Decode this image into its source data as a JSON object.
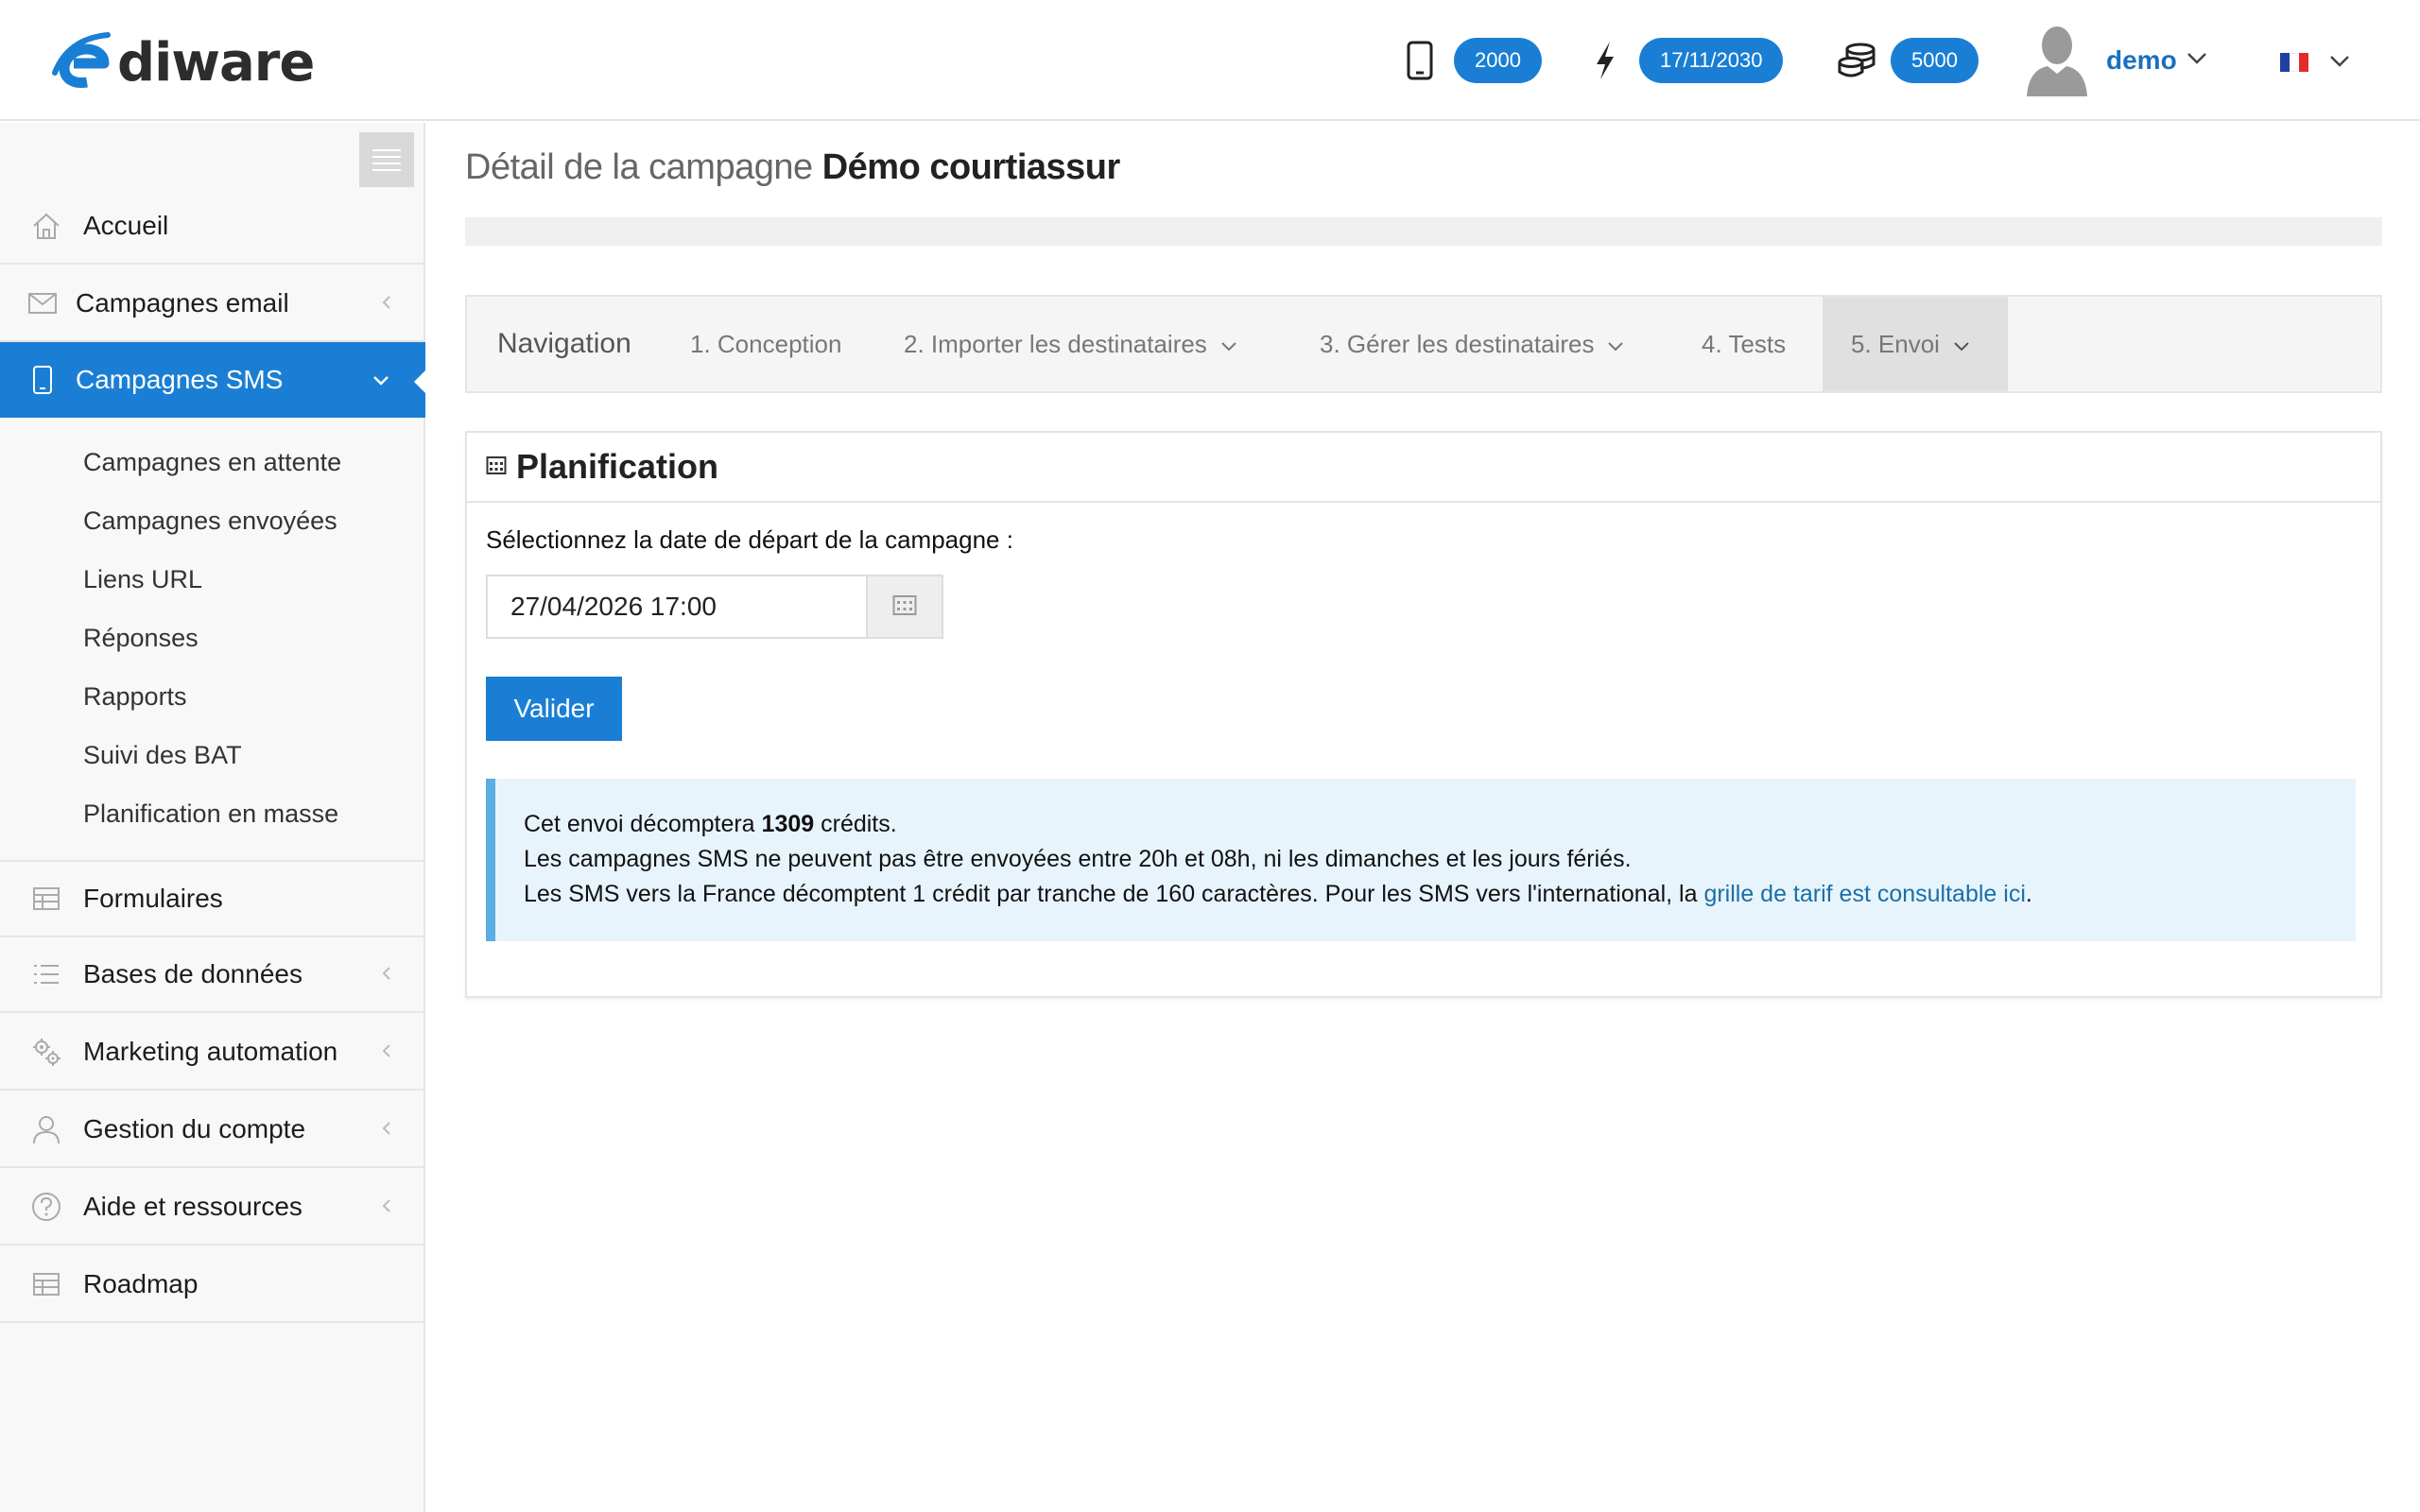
{
  "header": {
    "logo_text": "diware",
    "sms_count": "2000",
    "expiry_date": "17/11/2030",
    "credits": "5000",
    "user_name": "demo",
    "language": "FR"
  },
  "sidebar": {
    "items": [
      {
        "label": "Accueil"
      },
      {
        "label": "Campagnes email"
      },
      {
        "label": "Campagnes SMS"
      },
      {
        "label": "Formulaires"
      },
      {
        "label": "Bases de données"
      },
      {
        "label": "Marketing automation"
      },
      {
        "label": "Gestion du compte"
      },
      {
        "label": "Aide et ressources"
      },
      {
        "label": "Roadmap"
      }
    ],
    "sms_submenu": [
      "Campagnes en attente",
      "Campagnes envoyées",
      "Liens URL",
      "Réponses",
      "Rapports",
      "Suivi des BAT",
      "Planification en masse"
    ]
  },
  "main": {
    "title_prefix": "Détail de la campagne",
    "title_name": "Démo courtiassur",
    "tabs": {
      "nav": "Navigation",
      "t1": "1. Conception",
      "t2": "2. Importer les destinataires",
      "t3": "3. Gérer les destinataires",
      "t4": "4. Tests",
      "t5": "5. Envoi"
    },
    "panel": {
      "title": "Planification",
      "field_label": "Sélectionnez la date de départ de la campagne :",
      "date_value": "27/04/2026 17:00",
      "submit": "Valider",
      "alert": {
        "line1_pre": "Cet envoi décomptera",
        "credits": "1309",
        "line1_post": "crédits.",
        "line2": "Les campagnes SMS ne peuvent pas être envoyées entre 20h et 08h, ni les dimanches et les jours fériés.",
        "line3_pre": "Les SMS vers la France décomptent 1 crédit par tranche de 160 caractères. Pour les SMS vers l'international, la",
        "link": "grille de tarif est consultable ici",
        "line3_post": "."
      }
    }
  },
  "colors": {
    "accent": "#1a7fd4",
    "alert_bg": "#e8f4fc",
    "alert_border": "#5aaee2",
    "link": "#1a6fa8"
  }
}
